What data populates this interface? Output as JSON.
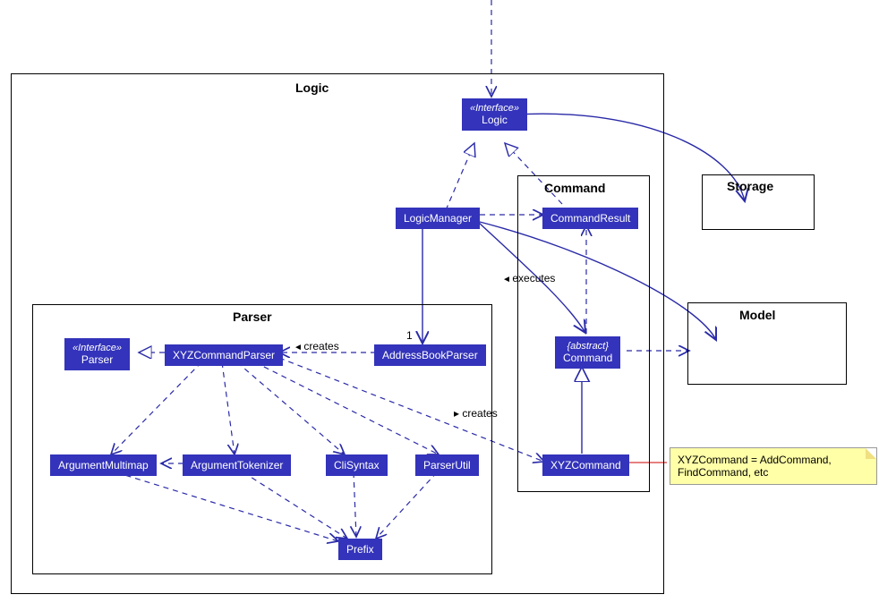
{
  "packages": {
    "logic": "Logic",
    "parser": "Parser",
    "command": "Command",
    "storage": "Storage",
    "model": "Model"
  },
  "classes": {
    "logic_interface_stereo": "«Interface»",
    "logic_interface_name": "Logic",
    "logic_manager": "LogicManager",
    "command_result": "CommandResult",
    "abstract_command_stereo": "{abstract}",
    "abstract_command_name": "Command",
    "xyz_command": "XYZCommand",
    "parser_interface_stereo": "«Interface»",
    "parser_interface_name": "Parser",
    "xyz_command_parser": "XYZCommandParser",
    "address_book_parser": "AddressBookParser",
    "argument_multimap": "ArgumentMultimap",
    "argument_tokenizer": "ArgumentTokenizer",
    "cli_syntax": "CliSyntax",
    "parser_util": "ParserUtil",
    "prefix": "Prefix"
  },
  "labels": {
    "executes": "executes",
    "creates1": "creates",
    "creates2": "creates",
    "mult1": "1"
  },
  "note_text": "XYZCommand = AddCommand, FindCommand, etc"
}
